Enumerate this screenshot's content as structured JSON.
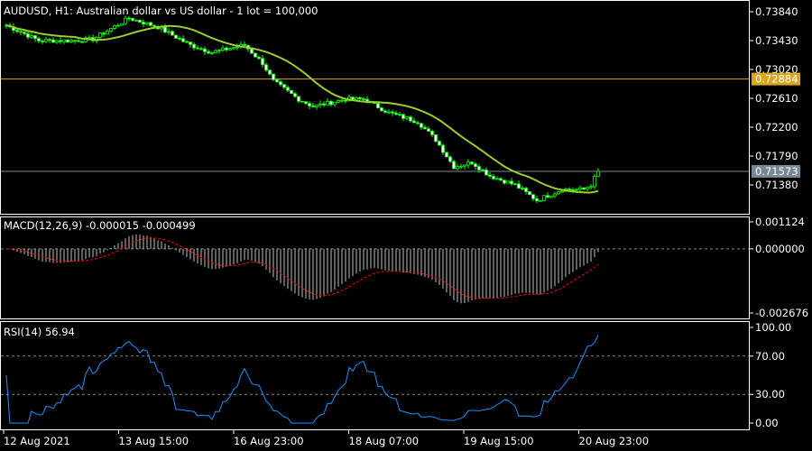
{
  "chart_data": {
    "type": "candlestick",
    "title": "AUDUSD, H1:  Australian dollar vs US dollar - 1 lot = 100,000",
    "bars": 165,
    "close_anchors": [
      [
        0,
        0.73648
      ],
      [
        9,
        0.7343
      ],
      [
        19,
        0.7343
      ],
      [
        24,
        0.7345
      ],
      [
        34,
        0.7375
      ],
      [
        42,
        0.73622
      ],
      [
        51,
        0.73366
      ],
      [
        57,
        0.73263
      ],
      [
        66,
        0.73366
      ],
      [
        71,
        0.7311
      ],
      [
        74,
        0.72853
      ],
      [
        81,
        0.72597
      ],
      [
        85,
        0.72495
      ],
      [
        94,
        0.72597
      ],
      [
        99,
        0.72597
      ],
      [
        106,
        0.72405
      ],
      [
        114,
        0.72277
      ],
      [
        119,
        0.72021
      ],
      [
        124,
        0.71637
      ],
      [
        129,
        0.717
      ],
      [
        134,
        0.71508
      ],
      [
        141,
        0.7138
      ],
      [
        147,
        0.71162
      ],
      [
        154,
        0.71316
      ],
      [
        160,
        0.71316
      ],
      [
        162,
        0.7138
      ],
      [
        164,
        0.71573
      ]
    ],
    "price_axis": {
      "ticks": [
        "0.73840",
        "0.73430",
        "0.73020",
        "0.72610",
        "0.72200",
        "0.71790",
        "0.71380"
      ],
      "range": [
        0.71162,
        0.7395
      ]
    },
    "horizontal_line": "0.72884",
    "bid_price": "0.71573",
    "time_labels": [
      "12 Aug 2021",
      "13 Aug 15:00",
      "16 Aug 23:00",
      "18 Aug 07:00",
      "19 Aug 15:00",
      "20 Aug 23:00"
    ],
    "ma_period": 20,
    "macd": {
      "label": "MACD(12,26,9) -0.000015 -0.000499",
      "ticks": [
        "0.001124",
        "0.000000",
        "-0.002676"
      ],
      "range": [
        -0.002676,
        0.001124
      ]
    },
    "rsi": {
      "label": "RSI(14) 56.94",
      "ticks": [
        "100.00",
        "70.00",
        "30.00",
        "0.00"
      ],
      "range": [
        0,
        100
      ],
      "levels": [
        70,
        30
      ]
    }
  },
  "colors": {
    "candle": "#00ff00",
    "ma": "#9acd32",
    "hline": "#daa520",
    "bid": "#778899",
    "macd_signal": "#ff0000",
    "rsi": "#1e90ff",
    "macd_hist": "#c0c0c0"
  }
}
